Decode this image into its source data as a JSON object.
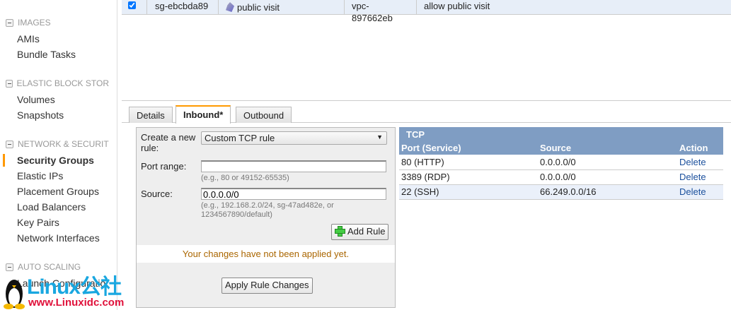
{
  "sidebar": {
    "sections": [
      {
        "title": "IMAGES",
        "items": [
          "AMIs",
          "Bundle Tasks"
        ]
      },
      {
        "title": "ELASTIC BLOCK STOR",
        "items": [
          "Volumes",
          "Snapshots"
        ]
      },
      {
        "title": "NETWORK & SECURIT",
        "items": [
          "Security Groups",
          "Elastic IPs",
          "Placement Groups",
          "Load Balancers",
          "Key Pairs",
          "Network Interfaces"
        ]
      },
      {
        "title": "AUTO SCALING",
        "items": [
          "Launch Configuratio"
        ]
      }
    ]
  },
  "selected_group": {
    "id": "sg-ebcbda89",
    "name": "public visit",
    "vpc": "vpc-897662eb",
    "description": "allow public visit"
  },
  "tabs": [
    "Details",
    "Inbound*",
    "Outbound"
  ],
  "form": {
    "rule_label": "Create a new rule:",
    "rule_value": "Custom TCP rule",
    "port_label": "Port range:",
    "port_value": "",
    "port_hint": "(e.g., 80 or 49152-65535)",
    "source_label": "Source:",
    "source_value": "0.0.0.0/0",
    "source_hint": "(e.g., 192.168.2.0/24, sg-47ad482e, or 1234567890/default)",
    "add_rule": "Add Rule",
    "message": "Your changes have not been applied yet.",
    "apply": "Apply Rule Changes"
  },
  "rules": {
    "group": "TCP",
    "headers": [
      "Port (Service)",
      "Source",
      "Action"
    ],
    "rows": [
      {
        "port": "80 (HTTP)",
        "source": "0.0.0.0/0",
        "action": "Delete"
      },
      {
        "port": "3389 (RDP)",
        "source": "0.0.0.0/0",
        "action": "Delete"
      },
      {
        "port": "22 (SSH)",
        "source": "66.249.0.0/16",
        "action": "Delete"
      }
    ]
  },
  "watermark": {
    "brand": "Linux公社",
    "url": "www.Linuxidc.com"
  }
}
